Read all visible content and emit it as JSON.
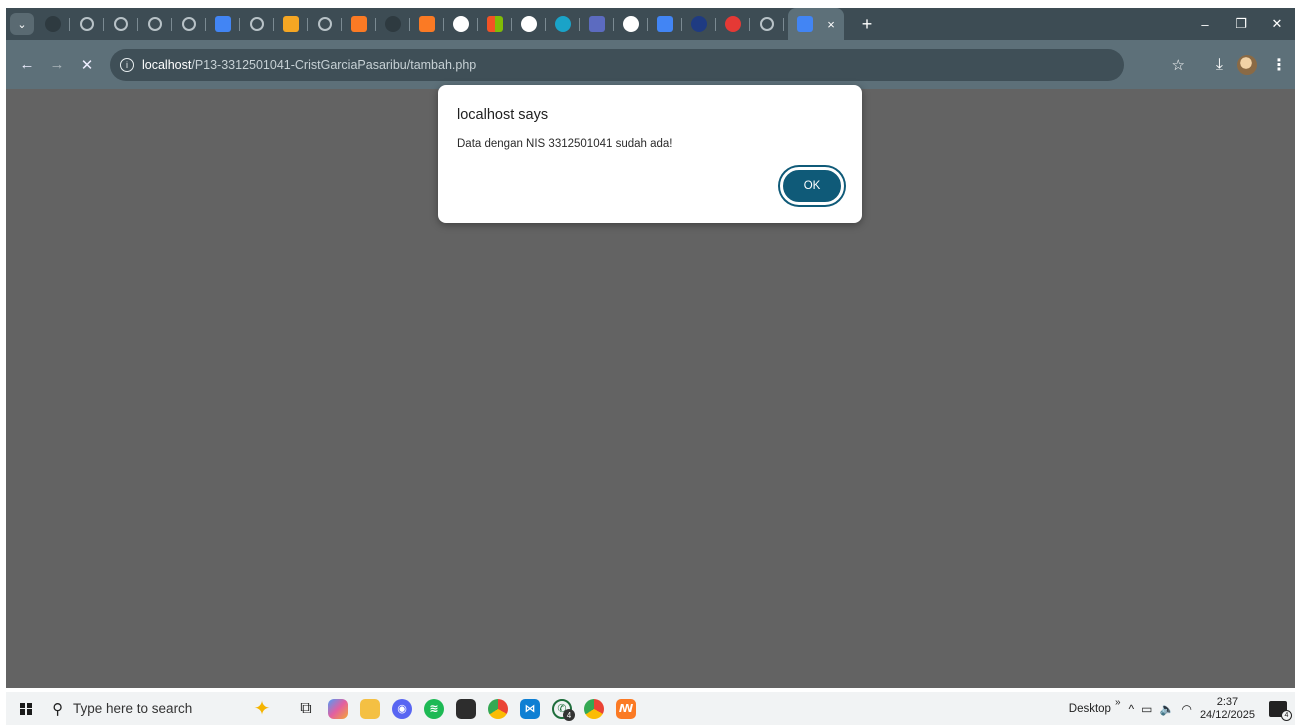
{
  "browser": {
    "tab_search_icon": "chevron-down-icon",
    "tabs": [
      {
        "icon": "github-icon",
        "style": "dark"
      },
      {
        "icon": "globe-icon",
        "style": "grey"
      },
      {
        "icon": "globe-icon",
        "style": "grey"
      },
      {
        "icon": "globe-icon",
        "style": "grey"
      },
      {
        "icon": "globe-icon",
        "style": "grey"
      },
      {
        "icon": "google-docs-icon",
        "style": "doc"
      },
      {
        "icon": "globe-icon",
        "style": "grey"
      },
      {
        "icon": "claude-icon",
        "style": "orange"
      },
      {
        "icon": "globe-icon",
        "style": "grey"
      },
      {
        "icon": "xampp-icon",
        "style": "xampp"
      },
      {
        "icon": "github-icon",
        "style": "dark"
      },
      {
        "icon": "xampp-icon",
        "style": "xampp"
      },
      {
        "icon": "chrome-icon",
        "style": "chrome"
      },
      {
        "icon": "microsoft-icon",
        "style": "ms"
      },
      {
        "icon": "google-icon",
        "style": "g"
      },
      {
        "icon": "cloud-icon",
        "style": "teal"
      },
      {
        "icon": "forms-icon",
        "style": "purple"
      },
      {
        "icon": "chrome-icon",
        "style": "chrome"
      },
      {
        "icon": "google-docs-icon",
        "style": "doc"
      },
      {
        "icon": "site-icon",
        "style": "navy"
      },
      {
        "icon": "heart-icon",
        "style": "red"
      },
      {
        "icon": "globe-icon",
        "style": "grey"
      }
    ],
    "active_tab": {
      "icon": "google-docs-icon",
      "close_icon": "×"
    },
    "new_tab_label": "+",
    "window_controls": {
      "minimize": "–",
      "restore": "❐",
      "close": "✕"
    },
    "toolbar": {
      "back": "←",
      "forward": "→",
      "stop": "✕",
      "info": "i",
      "url_host": "localhost",
      "url_path": "/P13-3312501041-CristGarciaPasaribu/tambah.php",
      "star": "☆",
      "download": "⤓",
      "menu": "⋮"
    }
  },
  "dialog": {
    "title": "localhost says",
    "message": "Data dengan NIS 3312501041 sudah ada!",
    "ok_label": "OK"
  },
  "taskbar": {
    "search_placeholder": "Type here to search",
    "apps": [
      {
        "name": "taskbar-task-view",
        "style": "taskview",
        "glyph": "⧉"
      },
      {
        "name": "taskbar-copilot",
        "style": "copilot",
        "glyph": ""
      },
      {
        "name": "taskbar-file-explorer",
        "style": "files",
        "glyph": ""
      },
      {
        "name": "taskbar-discord",
        "style": "discord",
        "glyph": "◉"
      },
      {
        "name": "taskbar-spotify",
        "style": "spotify",
        "glyph": "≋"
      },
      {
        "name": "taskbar-sticky-notes",
        "style": "sticky",
        "glyph": ""
      },
      {
        "name": "taskbar-chrome",
        "style": "chrome",
        "glyph": ""
      },
      {
        "name": "taskbar-vscode",
        "style": "vscode",
        "glyph": "⋈"
      },
      {
        "name": "taskbar-whatsapp",
        "style": "whatsapp",
        "glyph": "✆",
        "badge": "4"
      },
      {
        "name": "taskbar-chrome-profile",
        "style": "chrome",
        "glyph": ""
      },
      {
        "name": "taskbar-xampp",
        "style": "xampp",
        "glyph": "ꟿ"
      }
    ],
    "tray": {
      "desktop_label": "Desktop",
      "overflow": "»",
      "icons": [
        "^",
        "▭",
        "🔈",
        "◠"
      ],
      "time": "2:37",
      "date": "24/12/2025",
      "notification_count": "4"
    }
  }
}
